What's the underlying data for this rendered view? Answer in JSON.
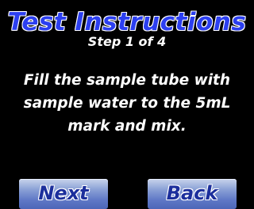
{
  "screen": {
    "title": "Test Instructions",
    "step": "Step 1 of 4",
    "instruction": "Fill the sample tube with sample water to the 5mL mark and mix."
  },
  "buttons": {
    "next_label": "Next",
    "back_label": "Back"
  },
  "colors": {
    "background": "#000000",
    "title": "#2c3ff0",
    "text": "#ffffff",
    "button_text": "#1c2f9c"
  }
}
